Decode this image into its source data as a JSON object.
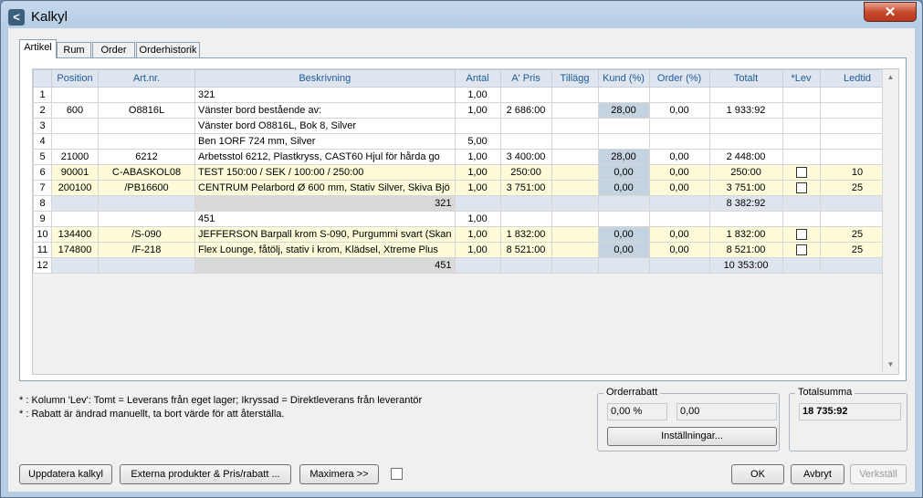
{
  "window": {
    "title": "Kalkyl",
    "close_glyph": "✕"
  },
  "tabs": [
    {
      "label": "Artikel"
    },
    {
      "label": "Rum"
    },
    {
      "label": "Order"
    },
    {
      "label": "Orderhistorik"
    }
  ],
  "grid": {
    "columns": [
      "",
      "Position",
      "Art.nr.",
      "Beskrivning",
      "Antal",
      "A' Pris",
      "Tillägg",
      "Kund (%)",
      "Order (%)",
      "Totalt",
      "*Lev",
      "Ledtid"
    ],
    "rows": [
      {
        "n": "1",
        "type": "blank",
        "pos": "",
        "art": "",
        "desc": "321",
        "antal": "1,00",
        "pris": "",
        "tillagg": "",
        "kund": "",
        "order": "",
        "totalt": "",
        "lev": false,
        "ledtid": ""
      },
      {
        "n": "2",
        "type": "blank",
        "pos": "600",
        "art": "O8816L",
        "desc": "Vänster bord bestående av:",
        "antal": "1,00",
        "pris": "2 686:00",
        "tillagg": "",
        "kund": "28,00",
        "order": "0,00",
        "totalt": "1 933:92",
        "lev": false,
        "ledtid": ""
      },
      {
        "n": "3",
        "type": "blank",
        "pos": "",
        "art": "",
        "desc": "Vänster bord O8816L, Bok 8, Silver",
        "antal": "",
        "pris": "",
        "tillagg": "",
        "kund": "",
        "order": "",
        "totalt": "",
        "lev": false,
        "ledtid": ""
      },
      {
        "n": "4",
        "type": "blank",
        "pos": "",
        "art": "",
        "desc": "Ben 1ORF 724 mm, Silver",
        "antal": "5,00",
        "pris": "",
        "tillagg": "",
        "kund": "",
        "order": "",
        "totalt": "",
        "lev": false,
        "ledtid": ""
      },
      {
        "n": "5",
        "type": "blank",
        "pos": "21000",
        "art": "6212",
        "desc": "Arbetsstol 6212, Plastkryss, CAST60 Hjul för hårda go",
        "antal": "1,00",
        "pris": "3 400:00",
        "tillagg": "",
        "kund": "28,00",
        "order": "0,00",
        "totalt": "2 448:00",
        "lev": false,
        "ledtid": ""
      },
      {
        "n": "6",
        "type": "prod",
        "pos": "90001",
        "art": "C-ABASKOL08",
        "desc": "TEST  150:00 / SEK / 100:00 / 250:00",
        "antal": "1,00",
        "pris": "250:00",
        "tillagg": "",
        "kund": "0,00",
        "order": "0,00",
        "totalt": "250:00",
        "lev": true,
        "ledtid": "10"
      },
      {
        "n": "7",
        "type": "prod",
        "pos": "200100",
        "art": "/PB16600",
        "desc": "CENTRUM Pelarbord Ø 600 mm, Stativ Silver, Skiva Bjö",
        "antal": "1,00",
        "pris": "3 751:00",
        "tillagg": "",
        "kund": "0,00",
        "order": "0,00",
        "totalt": "3 751:00",
        "lev": true,
        "ledtid": "25"
      },
      {
        "n": "8",
        "type": "sum",
        "pos": "",
        "art": "",
        "desc": "321",
        "antal": "",
        "pris": "",
        "tillagg": "",
        "kund": "",
        "order": "",
        "totalt": "8 382:92",
        "lev": false,
        "ledtid": ""
      },
      {
        "n": "9",
        "type": "blank",
        "pos": "",
        "art": "",
        "desc": "451",
        "antal": "1,00",
        "pris": "",
        "tillagg": "",
        "kund": "",
        "order": "",
        "totalt": "",
        "lev": false,
        "ledtid": ""
      },
      {
        "n": "10",
        "type": "prod",
        "pos": "134400",
        "art": "/S-090",
        "desc": "JEFFERSON Barpall krom S-090, Purgummi svart (Skan",
        "antal": "1,00",
        "pris": "1 832:00",
        "tillagg": "",
        "kund": "0,00",
        "order": "0,00",
        "totalt": "1 832:00",
        "lev": true,
        "ledtid": "25"
      },
      {
        "n": "11",
        "type": "prod",
        "pos": "174800",
        "art": "/F-218",
        "desc": "Flex Lounge, fåtölj, stativ i krom, Klädsel, Xtreme Plus",
        "antal": "1,00",
        "pris": "8 521:00",
        "tillagg": "",
        "kund": "0,00",
        "order": "0,00",
        "totalt": "8 521:00",
        "lev": true,
        "ledtid": "25"
      },
      {
        "n": "12",
        "type": "sum",
        "pos": "",
        "art": "",
        "desc": "451",
        "antal": "",
        "pris": "",
        "tillagg": "",
        "kund": "",
        "order": "",
        "totalt": "10 353:00",
        "lev": false,
        "ledtid": ""
      }
    ]
  },
  "notes": {
    "lev": "* : Kolumn 'Lev': Tomt = Leverans från eget lager; Ikryssad = Direktleverans från leverantör",
    "rabatt": "* : Rabatt är ändrad manuellt, ta bort värde för att återställa."
  },
  "orderrabatt": {
    "legend": "Orderrabatt",
    "percent": "0,00 %",
    "amount": "0,00",
    "settings_label": "Inställningar..."
  },
  "totalsumma": {
    "legend": "Totalsumma",
    "value": "18 735:92"
  },
  "buttons": {
    "update": "Uppdatera kalkyl",
    "external": "Externa produkter & Pris/rabatt ...",
    "maximize": "Maximera >>",
    "ok": "OK",
    "cancel": "Avbryt",
    "apply": "Verkställ"
  },
  "colors": {
    "header_text": "#1d5a9a",
    "product_row": "#fdfbd9",
    "sum_row": "#dee5ee",
    "kund_cell": "#c5d2e0"
  }
}
